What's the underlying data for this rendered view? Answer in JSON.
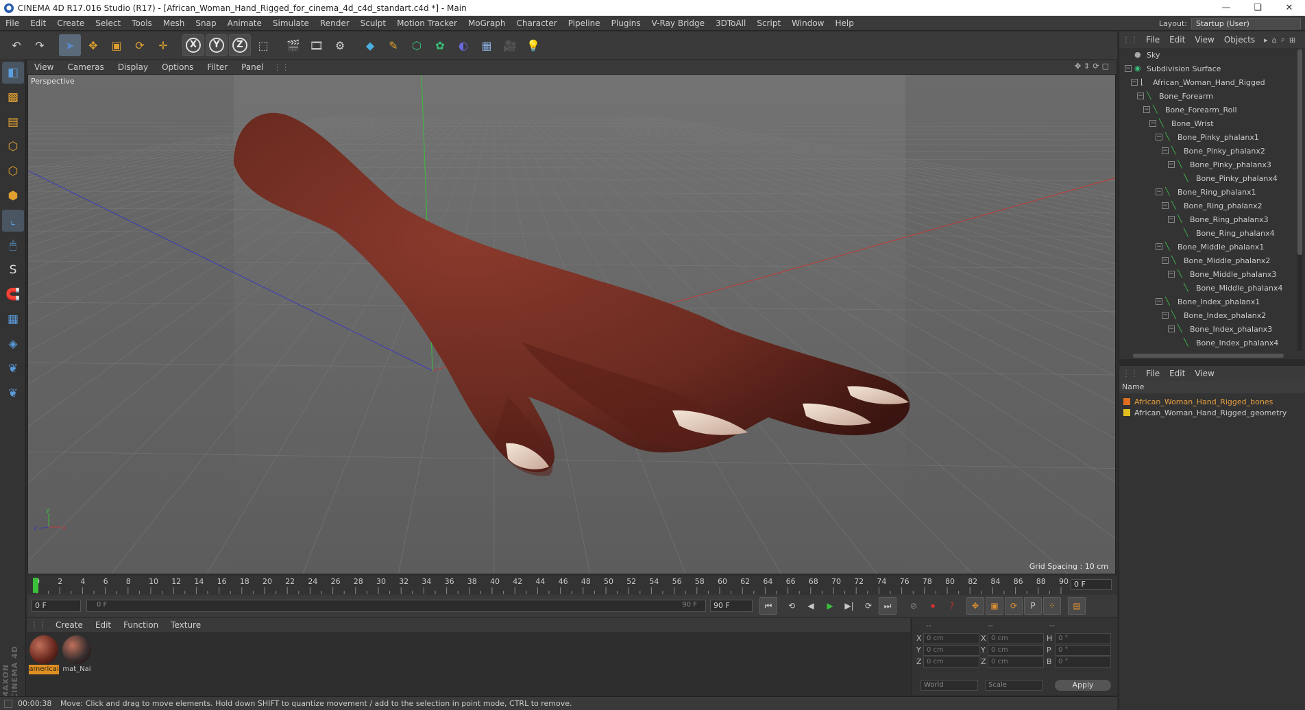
{
  "window": {
    "title": "CINEMA 4D R17.016 Studio (R17) - [African_Woman_Hand_Rigged_for_cinema_4d_c4d_standart.c4d *] - Main"
  },
  "menubar": {
    "items": [
      "File",
      "Edit",
      "Create",
      "Select",
      "Tools",
      "Mesh",
      "Snap",
      "Animate",
      "Simulate",
      "Render",
      "Sculpt",
      "Motion Tracker",
      "MoGraph",
      "Character",
      "Pipeline",
      "Plugins",
      "V-Ray Bridge",
      "3DToAll",
      "Script",
      "Window",
      "Help"
    ],
    "layout_label": "Layout:",
    "layout_value": "Startup (User)"
  },
  "toolbar": {
    "icons": [
      "undo-icon",
      "redo-icon",
      "select-icon",
      "move-icon",
      "scale-icon",
      "rotate-icon",
      "transform-icon",
      "x-axis-icon",
      "y-axis-icon",
      "z-axis-icon",
      "coordinate-system-icon",
      "render-view-icon",
      "render-picture-viewer-icon",
      "render-settings-icon",
      "cube-icon",
      "pen-icon",
      "subdivision-icon",
      "cloner-icon",
      "deformer-icon",
      "floor-icon",
      "camera-icon",
      "light-icon"
    ],
    "axis_labels": [
      "X",
      "Y",
      "Z"
    ]
  },
  "leftbar": {
    "icons": [
      "model-mode-icon",
      "texture-mode-icon",
      "workplane-icon",
      "points-mode-icon",
      "edges-mode-icon",
      "polygons-mode-icon",
      "axis-mode-icon",
      "tweak-icon",
      "snap-s-icon",
      "magnet-icon",
      "grid-lock-icon",
      "sculpt-icon",
      "python-icon",
      "python2-icon"
    ]
  },
  "viewport": {
    "menu": [
      "View",
      "Cameras",
      "Display",
      "Options",
      "Filter",
      "Panel"
    ],
    "label": "Perspective",
    "grid_spacing": "Grid Spacing : 10 cm",
    "axis": {
      "x": "x",
      "y": "y",
      "z": "z"
    }
  },
  "timeline": {
    "ticks": [
      "0",
      "2",
      "4",
      "6",
      "8",
      "10",
      "12",
      "14",
      "16",
      "18",
      "20",
      "22",
      "24",
      "26",
      "28",
      "30",
      "32",
      "34",
      "36",
      "38",
      "40",
      "42",
      "44",
      "46",
      "48",
      "50",
      "52",
      "54",
      "56",
      "58",
      "60",
      "62",
      "64",
      "66",
      "68",
      "70",
      "72",
      "74",
      "76",
      "78",
      "80",
      "82",
      "84",
      "86",
      "88",
      "90"
    ],
    "current_frame": "0 F"
  },
  "transport": {
    "start": "0 F",
    "range_start": "0 F",
    "range_end": "90 F",
    "end": "90 F"
  },
  "materials": {
    "menu": [
      "Create",
      "Edit",
      "Function",
      "Texture"
    ],
    "items": [
      {
        "name": "americai",
        "color": "#6b2a20",
        "selected": true
      },
      {
        "name": "mat_Nai",
        "color": "#3a3030",
        "selected": false
      }
    ]
  },
  "coords": {
    "header": [
      "--",
      "--",
      "--"
    ],
    "rows": [
      {
        "a": "X",
        "av": "0 cm",
        "b": "X",
        "bv": "0 cm",
        "c": "H",
        "cv": "0 °"
      },
      {
        "a": "Y",
        "av": "0 cm",
        "b": "Y",
        "bv": "0 cm",
        "c": "P",
        "cv": "0 °"
      },
      {
        "a": "Z",
        "av": "0 cm",
        "b": "Z",
        "bv": "0 cm",
        "c": "B",
        "cv": "0 °"
      }
    ],
    "world": "World",
    "scale": "Scale",
    "apply": "Apply"
  },
  "status": {
    "time": "00:00:38",
    "message": "Move: Click and drag to move elements. Hold down SHIFT to quantize movement / add to the selection in point mode, CTRL to remove."
  },
  "objects": {
    "menu": [
      "File",
      "Edit",
      "View",
      "Objects"
    ],
    "tree": [
      {
        "name": "Sky",
        "depth": 0,
        "type": "sky"
      },
      {
        "name": "Subdivision Surface",
        "depth": 0,
        "type": "sub"
      },
      {
        "name": "African_Woman_Hand_Rigged",
        "depth": 1,
        "type": "null"
      },
      {
        "name": "Bone_Forearm",
        "depth": 2,
        "type": "bone"
      },
      {
        "name": "Bone_Forearm_Roll",
        "depth": 3,
        "type": "bone"
      },
      {
        "name": "Bone_Wrist",
        "depth": 4,
        "type": "bone"
      },
      {
        "name": "Bone_Pinky_phalanx1",
        "depth": 5,
        "type": "bone"
      },
      {
        "name": "Bone_Pinky_phalanx2",
        "depth": 6,
        "type": "bone"
      },
      {
        "name": "Bone_Pinky_phalanx3",
        "depth": 7,
        "type": "bone"
      },
      {
        "name": "Bone_Pinky_phalanx4",
        "depth": 8,
        "type": "bone"
      },
      {
        "name": "Bone_Ring_phalanx1",
        "depth": 5,
        "type": "bone"
      },
      {
        "name": "Bone_Ring_phalanx2",
        "depth": 6,
        "type": "bone"
      },
      {
        "name": "Bone_Ring_phalanx3",
        "depth": 7,
        "type": "bone"
      },
      {
        "name": "Bone_Ring_phalanx4",
        "depth": 8,
        "type": "bone"
      },
      {
        "name": "Bone_Middle_phalanx1",
        "depth": 5,
        "type": "bone"
      },
      {
        "name": "Bone_Middle_phalanx2",
        "depth": 6,
        "type": "bone"
      },
      {
        "name": "Bone_Middle_phalanx3",
        "depth": 7,
        "type": "bone"
      },
      {
        "name": "Bone_Middle_phalanx4",
        "depth": 8,
        "type": "bone"
      },
      {
        "name": "Bone_Index_phalanx1",
        "depth": 5,
        "type": "bone"
      },
      {
        "name": "Bone_Index_phalanx2",
        "depth": 6,
        "type": "bone"
      },
      {
        "name": "Bone_Index_phalanx3",
        "depth": 7,
        "type": "bone"
      },
      {
        "name": "Bone_Index_phalanx4",
        "depth": 8,
        "type": "bone"
      }
    ]
  },
  "layers": {
    "menu": [
      "File",
      "Edit",
      "View"
    ],
    "header": "Name",
    "items": [
      {
        "name": "African_Woman_Hand_Rigged_bones",
        "color": "#e07020",
        "text_color": "#e8a040"
      },
      {
        "name": "African_Woman_Hand_Rigged_geometry",
        "color": "#e0c020",
        "text_color": "#cccccc"
      }
    ]
  },
  "colors": {
    "accent": "#5a8ac8",
    "bone": "#3fbf4f",
    "skin": "#6b2a20"
  }
}
